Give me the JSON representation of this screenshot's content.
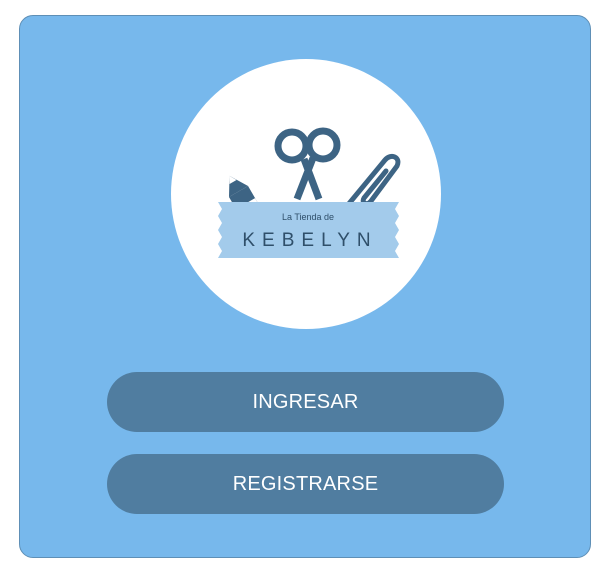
{
  "logo": {
    "line1": "La Tienda de",
    "line2": "KEBELYN"
  },
  "actions": {
    "login_label": "INGRESAR",
    "register_label": "REGISTRARSE"
  },
  "colors": {
    "card_background": "#77b8ec",
    "button_background": "#507da0",
    "logo_dark": "#3d6484",
    "logo_ribbon": "#a3cbeb"
  }
}
